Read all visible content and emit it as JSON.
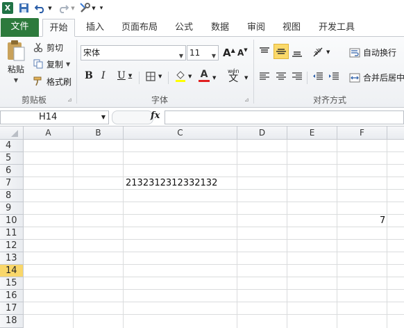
{
  "qat": {
    "excel_icon": "excel-logo-icon",
    "save_icon": "save-icon",
    "undo_icon": "undo-icon",
    "redo_icon": "redo-icon",
    "tools_icon": "tools-icon"
  },
  "tabs": [
    {
      "label": "文件"
    },
    {
      "label": "开始"
    },
    {
      "label": "插入"
    },
    {
      "label": "页面布局"
    },
    {
      "label": "公式"
    },
    {
      "label": "数据"
    },
    {
      "label": "审阅"
    },
    {
      "label": "视图"
    },
    {
      "label": "开发工具"
    }
  ],
  "ribbon": {
    "clipboard": {
      "paste": "粘贴",
      "cut": "剪切",
      "copy": "复制",
      "format_painter": "格式刷",
      "group_label": "剪贴板"
    },
    "font": {
      "font_name": "宋体",
      "font_size": "11",
      "bold": "B",
      "italic": "I",
      "underline": "U",
      "grow": "A",
      "shrink": "A",
      "font_color_letter": "A",
      "phonetic": "wén",
      "phonetic_char": "文",
      "group_label": "字体"
    },
    "alignment": {
      "wrap_text": "自动换行",
      "merge_center": "合并后居中",
      "group_label": "对齐方式"
    }
  },
  "formula_bar": {
    "name_box": "H14",
    "fx": "fx",
    "value": ""
  },
  "grid": {
    "columns": [
      "A",
      "B",
      "C",
      "D",
      "E",
      "F"
    ],
    "rows": [
      "4",
      "5",
      "6",
      "7",
      "8",
      "9",
      "10",
      "11",
      "12",
      "13",
      "14",
      "15",
      "16",
      "17",
      "18"
    ],
    "selected_row": "14",
    "cell_c7": "2132312312332132",
    "cell_f10": "7"
  },
  "colors": {
    "file_tab": "#2d7a3c",
    "selected_row_header": "#f9d76a"
  }
}
